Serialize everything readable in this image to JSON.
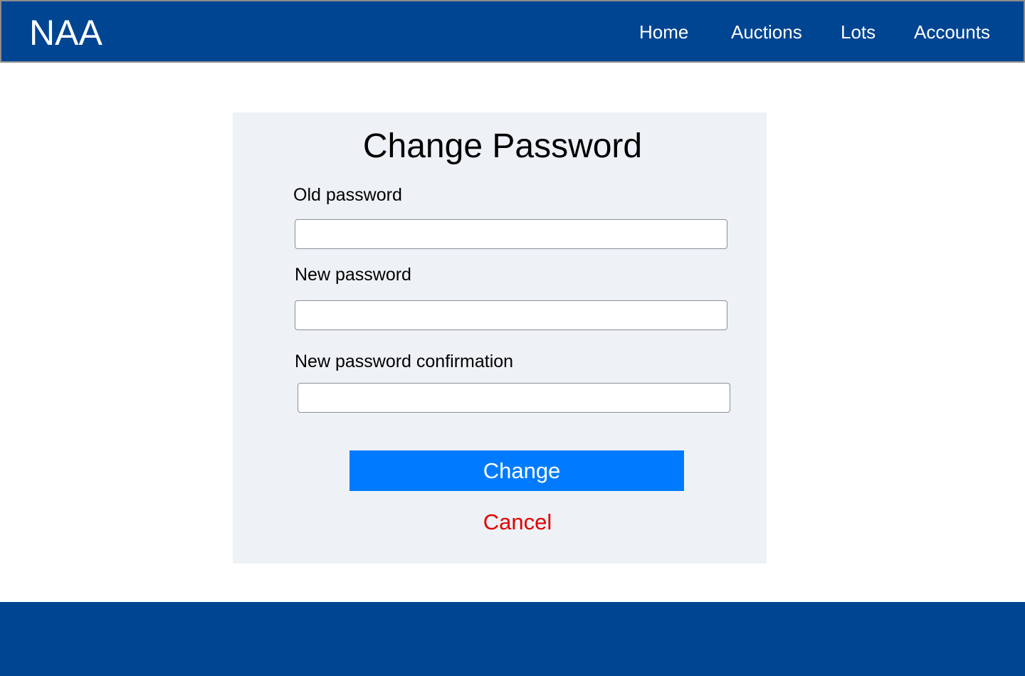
{
  "header": {
    "logo": "NAA",
    "nav": {
      "home": "Home",
      "auctions": "Auctions",
      "lots": "Lots",
      "accounts": "Accounts"
    }
  },
  "form": {
    "title": "Change Password",
    "old_password": {
      "label": "Old password",
      "value": "",
      "placeholder": ""
    },
    "new_password": {
      "label": "New password",
      "value": "",
      "placeholder": ""
    },
    "confirm_password": {
      "label": "New password confirmation",
      "value": "",
      "placeholder": ""
    },
    "submit_label": "Change",
    "cancel_label": "Cancel"
  },
  "colors": {
    "header_bg": "#004592",
    "panel_bg": "#eef2f6",
    "primary_button": "#007bff",
    "cancel_text": "#e10000",
    "footer_bg": "#004592"
  }
}
